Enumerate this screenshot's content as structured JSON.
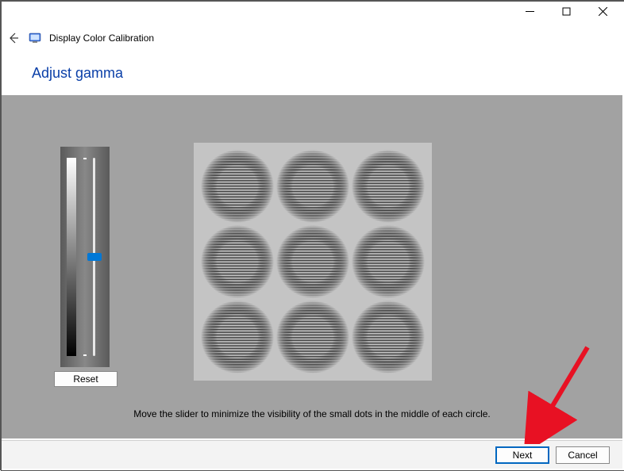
{
  "window": {
    "app_title": "Display Color Calibration"
  },
  "page": {
    "heading": "Adjust gamma",
    "instruction": "Move the slider to minimize the visibility of the small dots in the middle of each circle."
  },
  "slider": {
    "value_percent": 50,
    "reset_label": "Reset"
  },
  "footer": {
    "next_label": "Next",
    "cancel_label": "Cancel"
  }
}
